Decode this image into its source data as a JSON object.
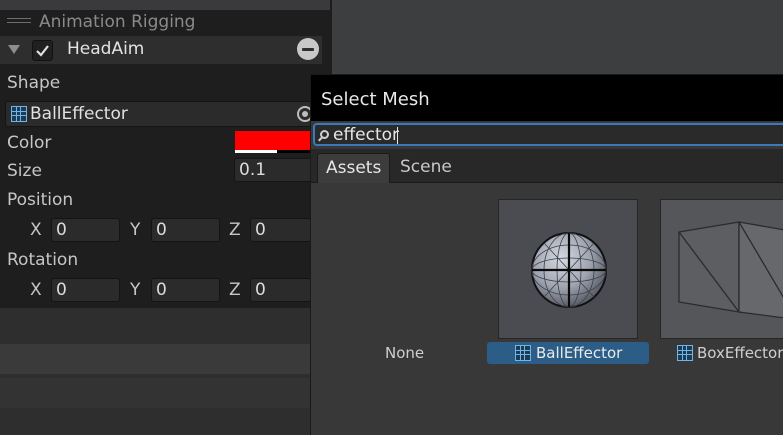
{
  "inspector": {
    "title": "Animation Rigging",
    "component": {
      "name": "HeadAim",
      "enabled": true
    },
    "shape": {
      "label": "Shape",
      "value": "BallEffector"
    },
    "color": {
      "label": "Color",
      "value": "#ff0000"
    },
    "size": {
      "label": "Size",
      "value": "0.1"
    },
    "position": {
      "label": "Position",
      "x": "0",
      "y": "0",
      "z": "0"
    },
    "rotation": {
      "label": "Rotation",
      "x": "0",
      "y": "0",
      "z": "0"
    },
    "axis_labels": {
      "x": "X",
      "y": "Y",
      "z": "Z"
    }
  },
  "picker": {
    "title": "Select Mesh",
    "search": {
      "value": "effector"
    },
    "tabs": [
      {
        "label": "Assets",
        "active": true
      },
      {
        "label": "Scene",
        "active": false
      }
    ],
    "items": [
      {
        "label": "None",
        "selected": false
      },
      {
        "label": "BallEffector",
        "selected": true,
        "icon": "mesh-icon"
      },
      {
        "label": "BoxEffector",
        "selected": false,
        "icon": "mesh-icon"
      }
    ]
  },
  "colors": {
    "accent": "#3a79bb",
    "selection": "#2c5d87",
    "swatch": "#ff0000"
  }
}
